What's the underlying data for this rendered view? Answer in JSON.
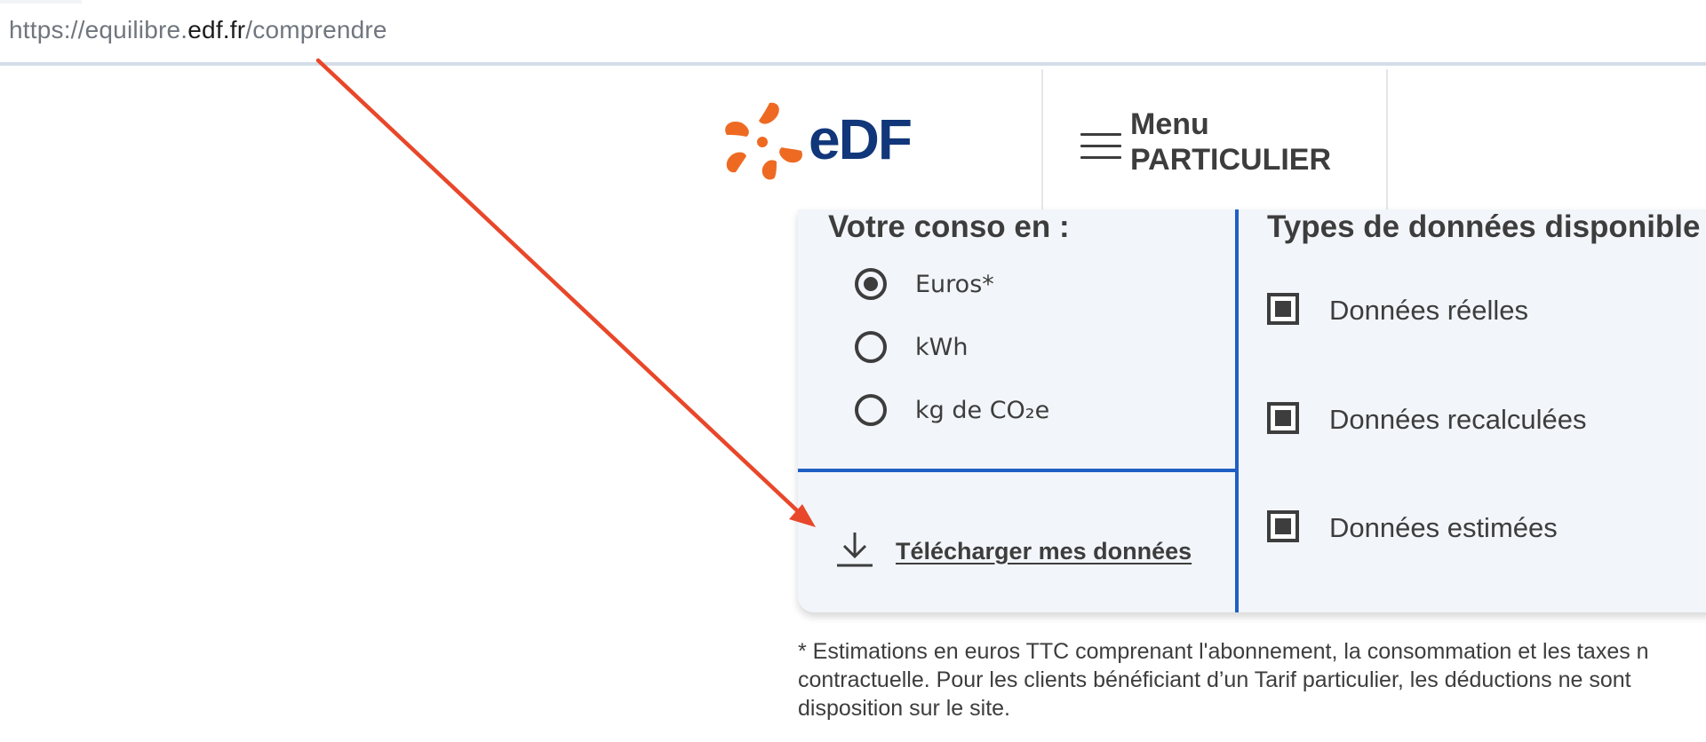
{
  "browser": {
    "url_scheme": "https://equilibre.",
    "url_domain": "edf.fr",
    "url_path": "/comprendre"
  },
  "header": {
    "logo_text": "eDF",
    "menu_label": "Menu",
    "menu_sublabel": "PARTICULIER"
  },
  "conso": {
    "title": "Votre conso en :",
    "options": [
      {
        "label": "Euros*",
        "selected": true
      },
      {
        "label": "kWh",
        "selected": false
      },
      {
        "label": "kg de CO₂e",
        "selected": false
      }
    ],
    "download_label": "Télécharger mes données"
  },
  "types": {
    "title": "Types de données disponible",
    "items": [
      {
        "label": "Données réelles",
        "checked": true
      },
      {
        "label": "Données recalculées",
        "checked": true
      },
      {
        "label": "Données estimées",
        "checked": true
      }
    ]
  },
  "footnote": {
    "line1": "* Estimations en euros TTC comprenant l'abonnement, la consommation et les taxes n",
    "line2": "contractuelle. Pour les clients bénéficiant d’un Tarif particulier, les déductions ne sont",
    "line3": "disposition sur le site."
  },
  "colors": {
    "edf_orange": "#ee6a22",
    "edf_blue": "#11377a",
    "accent_blue": "#1f5fc4",
    "annotation_arrow": "#e8472a"
  },
  "icons": {
    "download": "download-icon",
    "menu": "hamburger-menu-icon",
    "logo": "edf-logo"
  }
}
